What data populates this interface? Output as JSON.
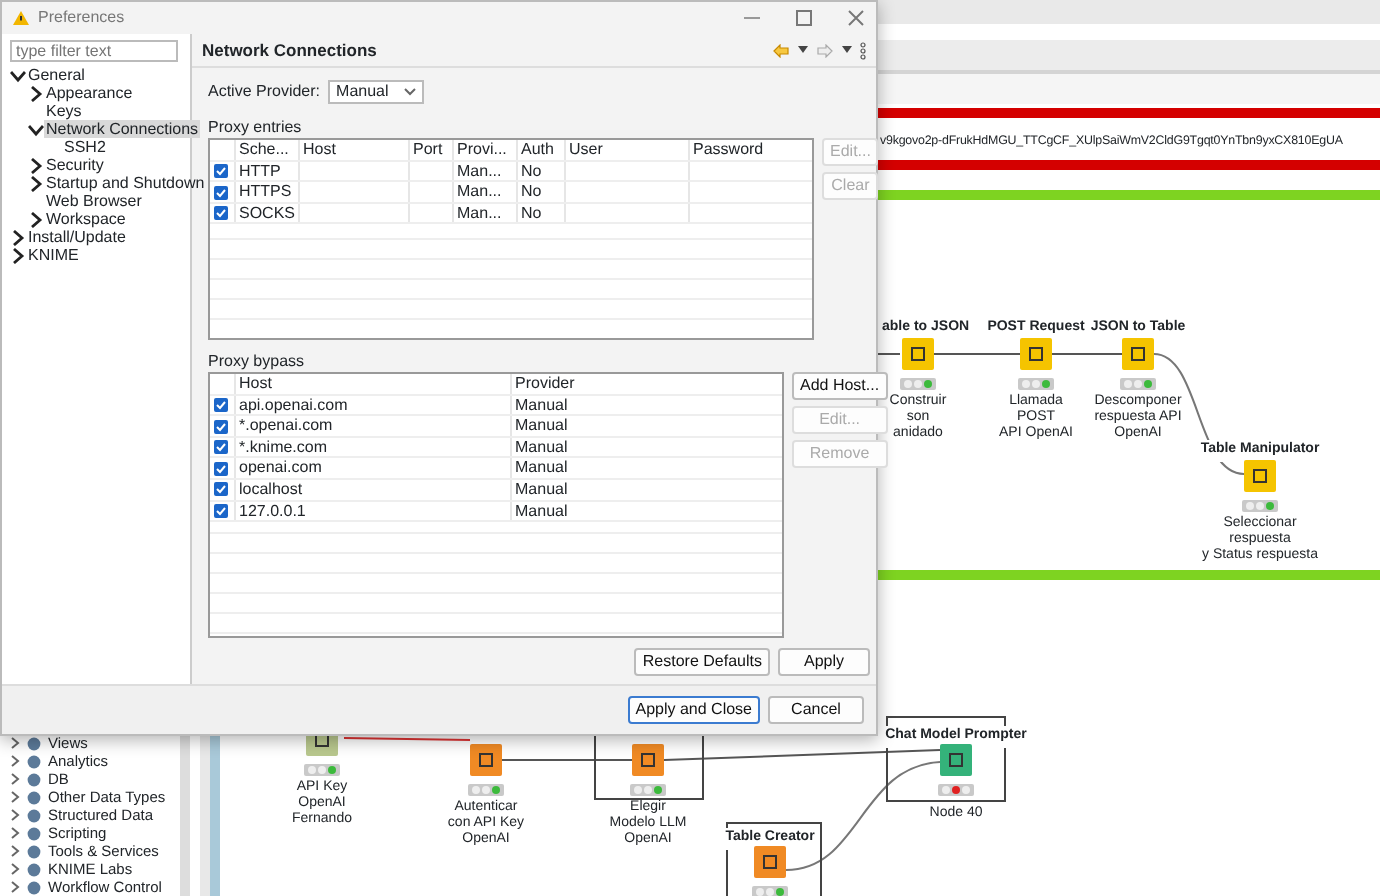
{
  "dialog": {
    "title": "Preferences",
    "filter": {
      "placeholder": "type filter text"
    },
    "tree": [
      {
        "label": "General",
        "kind": "branch",
        "expanded": true,
        "selected": false,
        "children": [
          {
            "label": "Appearance",
            "kind": "branch",
            "expanded": false,
            "selected": false
          },
          {
            "label": "Keys",
            "kind": "leaf",
            "selected": false
          },
          {
            "label": "Network Connections",
            "kind": "branch",
            "expanded": true,
            "selected": true,
            "children": [
              {
                "label": "SSH2",
                "kind": "leaf",
                "selected": false
              }
            ]
          },
          {
            "label": "Security",
            "kind": "branch",
            "expanded": false,
            "selected": false
          },
          {
            "label": "Startup and Shutdown",
            "kind": "branch",
            "expanded": false,
            "selected": false
          },
          {
            "label": "Web Browser",
            "kind": "leaf",
            "selected": false
          },
          {
            "label": "Workspace",
            "kind": "branch",
            "expanded": false,
            "selected": false
          }
        ]
      },
      {
        "label": "Install/Update",
        "kind": "branch",
        "expanded": false,
        "selected": false
      },
      {
        "label": "KNIME",
        "kind": "branch",
        "expanded": false,
        "selected": false
      }
    ],
    "page_title": "Network Connections",
    "active_provider": {
      "label": "Active Provider:",
      "value": "Manual"
    },
    "proxy_entries": {
      "title": "Proxy entries",
      "columns": [
        "Sche...",
        "Host",
        "Port",
        "Provi...",
        "Auth",
        "User",
        "Password"
      ],
      "rows": [
        {
          "checked": true,
          "cells": [
            "HTTP",
            "",
            "",
            "Man...",
            "No",
            "",
            ""
          ]
        },
        {
          "checked": true,
          "cells": [
            "HTTPS",
            "",
            "",
            "Man...",
            "No",
            "",
            ""
          ]
        },
        {
          "checked": true,
          "cells": [
            "SOCKS",
            "",
            "",
            "Man...",
            "No",
            "",
            ""
          ]
        }
      ],
      "buttons": [
        {
          "label": "Edit...",
          "disabled": true
        },
        {
          "label": "Clear",
          "disabled": true
        }
      ]
    },
    "proxy_bypass": {
      "title": "Proxy bypass",
      "columns": [
        "Host",
        "Provider"
      ],
      "rows": [
        {
          "checked": true,
          "cells": [
            "api.openai.com",
            "Manual"
          ]
        },
        {
          "checked": true,
          "cells": [
            "*.openai.com",
            "Manual"
          ]
        },
        {
          "checked": true,
          "cells": [
            "*.knime.com",
            "Manual"
          ]
        },
        {
          "checked": true,
          "cells": [
            "openai.com",
            "Manual"
          ]
        },
        {
          "checked": true,
          "cells": [
            "localhost",
            "Manual"
          ]
        },
        {
          "checked": true,
          "cells": [
            "127.0.0.1",
            "Manual"
          ]
        }
      ],
      "buttons": [
        {
          "label": "Add Host...",
          "disabled": false
        },
        {
          "label": "Edit...",
          "disabled": true
        },
        {
          "label": "Remove",
          "disabled": true
        }
      ]
    },
    "page_buttons": [
      "Restore Defaults",
      "Apply"
    ],
    "footer_buttons": [
      {
        "label": "Apply and Close",
        "default": true
      },
      {
        "label": "Cancel",
        "default": false
      }
    ]
  },
  "node_repository": [
    "Views",
    "Analytics",
    "DB",
    "Other Data Types",
    "Structured Data",
    "Scripting",
    "Tools & Services",
    "KNIME Labs",
    "Workflow Control"
  ],
  "canvas": {
    "annotation_text": "v9kgovo2p-dFrukHdMGU_TTCgCF_XUlpSaiWmV2CldG9Tgqt0YnTbn9yxCX810EgUA",
    "nodes": [
      {
        "title": "able to JSON",
        "label": "Construir\nson anidado",
        "color": "#f5c400",
        "failed": false
      },
      {
        "title": "POST Request",
        "label": "Llamada\nPOST\nAPI OpenAI",
        "color": "#f5c400",
        "failed": false
      },
      {
        "title": "JSON to Table",
        "label": "Descomponer\nrespuesta API\nOpenAI",
        "color": "#f5c400",
        "failed": false
      },
      {
        "title": "Table Manipulator",
        "label": "Seleccionar\nrespuesta\ny Status respuesta",
        "color": "#f5c400",
        "failed": false
      },
      {
        "label": "API Key\nOpenAI\nFernando",
        "color": "#b9c88e",
        "failed": false
      },
      {
        "label": "Autenticar\ncon API Key\nOpenAI",
        "color": "#f08a24",
        "failed": false
      },
      {
        "label": "Elegir\nModelo LLM\nOpenAI",
        "color": "#f08a24",
        "failed": false
      },
      {
        "title": "Chat Model Prompter",
        "label": "Node 40",
        "color": "#34b27a",
        "failed": true
      },
      {
        "title": "Table Creator",
        "color": "#f08a24",
        "failed": false
      }
    ]
  }
}
